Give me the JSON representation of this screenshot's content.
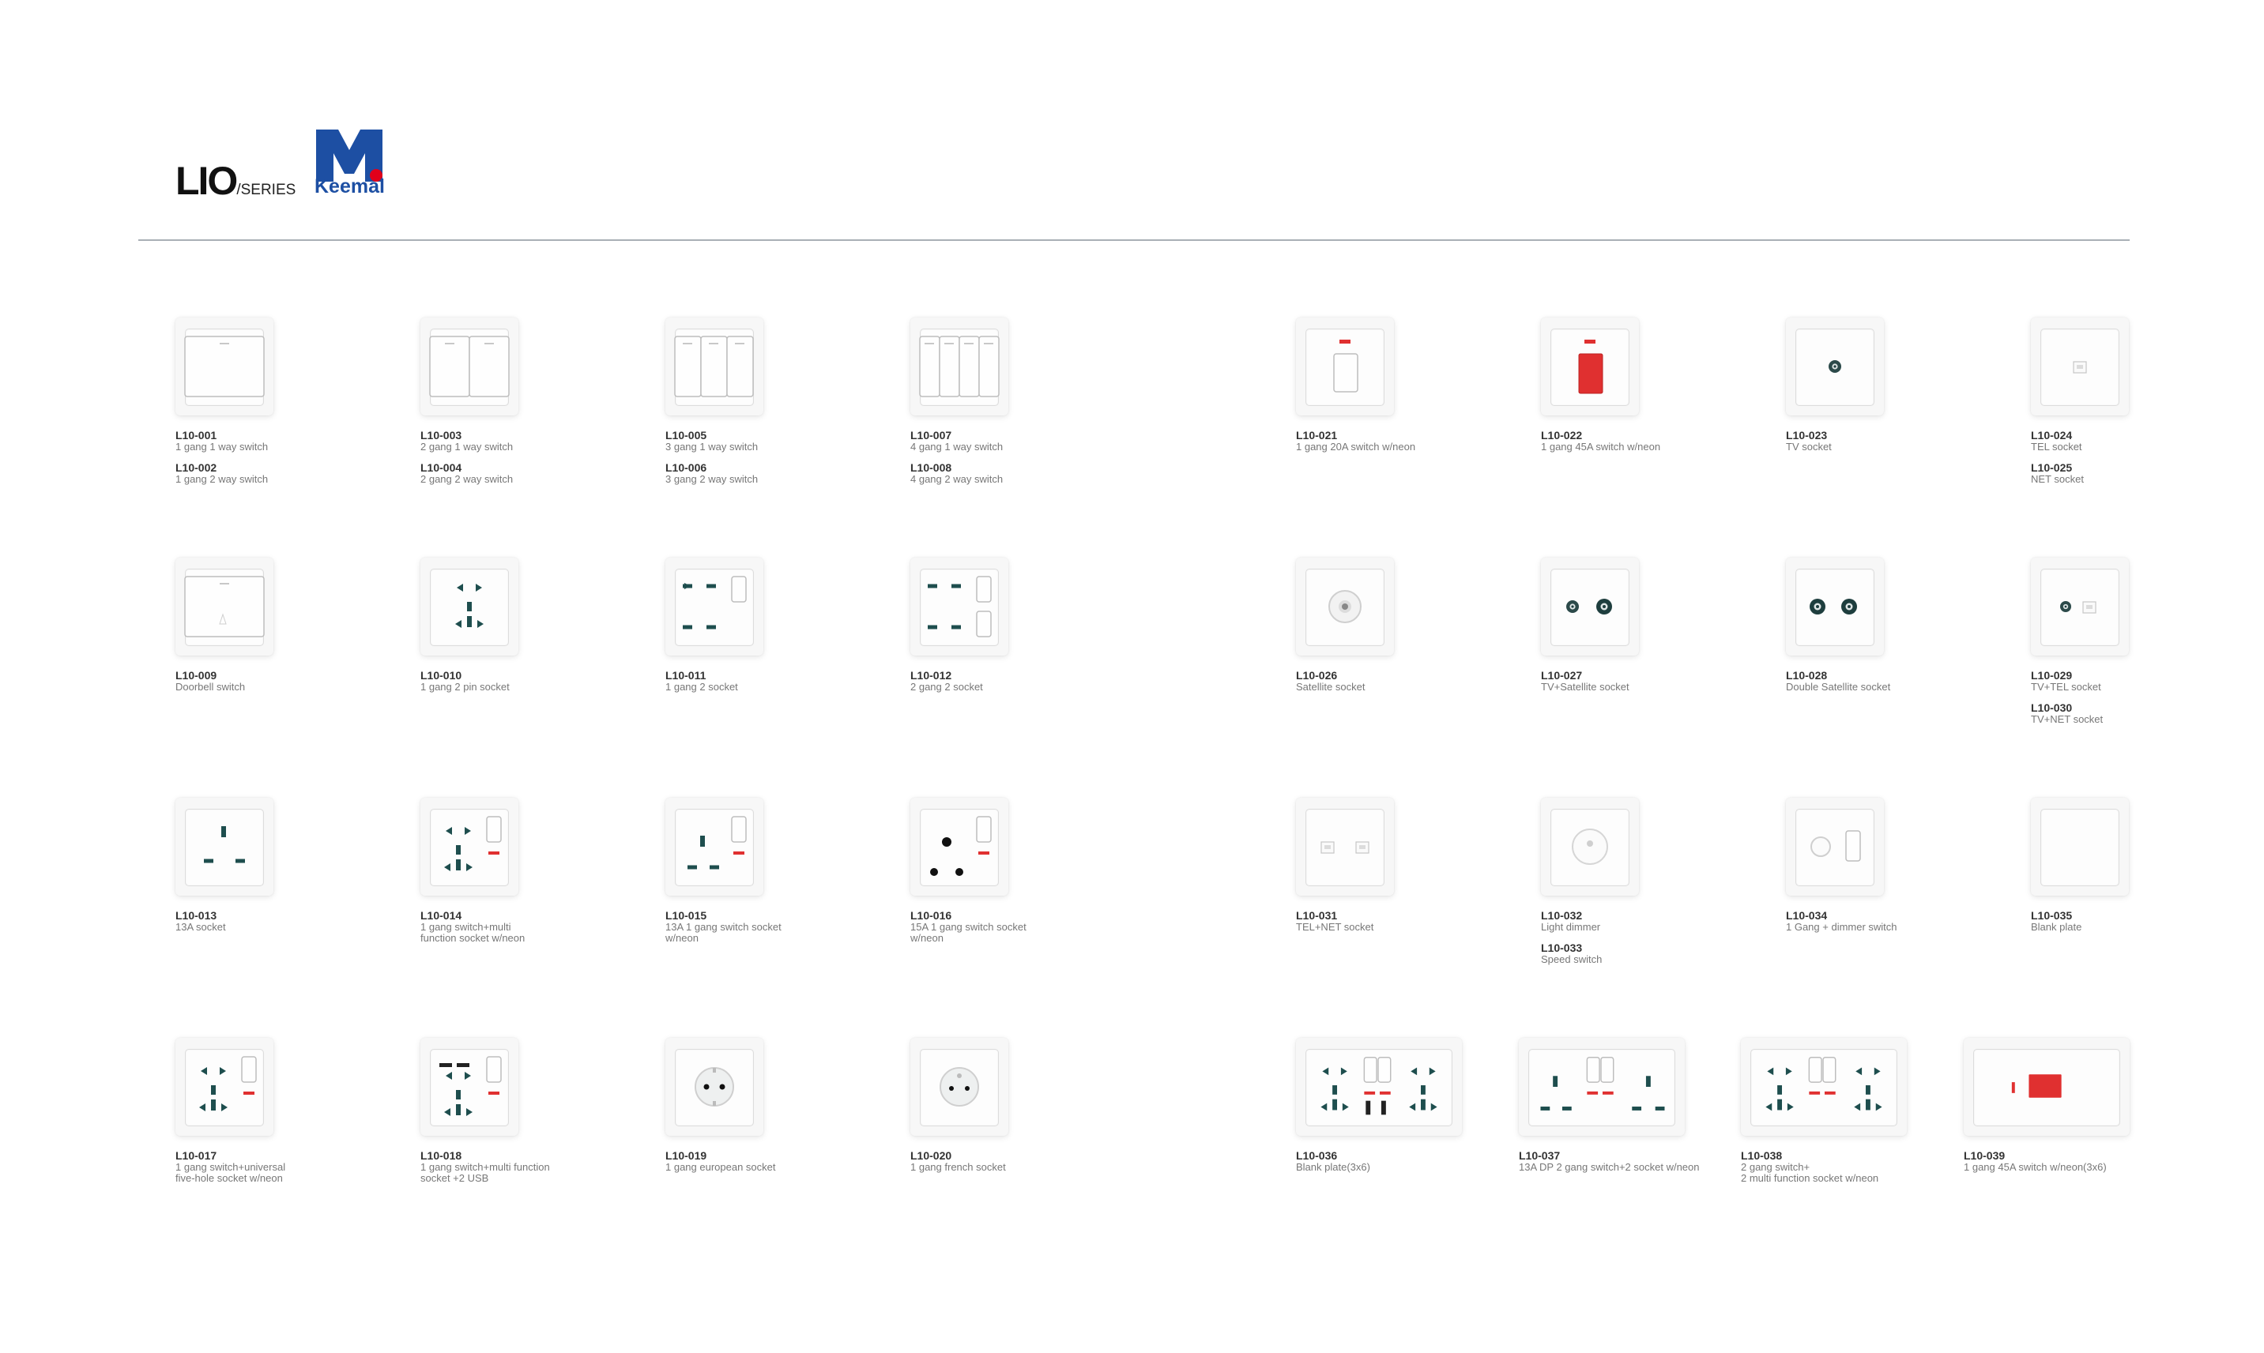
{
  "brand": {
    "series_big": "LIO",
    "series_small": "/SERIES",
    "logo_word": "Keemal"
  },
  "colors": {
    "accent_red": "#e03030",
    "socket_dark": "#1e4e4e",
    "logo_blue": "#1d4fa3",
    "logo_red": "#e1001a"
  },
  "products": [
    {
      "lines": [
        {
          "code": "L10-001",
          "desc": "1 gang 1 way switch"
        },
        {
          "code": "L10-002",
          "desc": "1 gang 2 way switch"
        }
      ],
      "icon": "switch-1-gang-icon"
    },
    {
      "lines": [
        {
          "code": "L10-003",
          "desc": "2 gang 1 way switch"
        },
        {
          "code": "L10-004",
          "desc": "2 gang 2 way switch"
        }
      ],
      "icon": "switch-2-gang-icon"
    },
    {
      "lines": [
        {
          "code": "L10-005",
          "desc": "3 gang 1 way switch"
        },
        {
          "code": "L10-006",
          "desc": "3 gang 2 way switch"
        }
      ],
      "icon": "switch-3-gang-icon"
    },
    {
      "lines": [
        {
          "code": "L10-007",
          "desc": "4 gang 1 way switch"
        },
        {
          "code": "L10-008",
          "desc": "4 gang 2 way switch"
        }
      ],
      "icon": "switch-4-gang-icon"
    },
    {
      "lines": [
        {
          "code": "L10-021",
          "desc": "1 gang 20A switch w/neon"
        }
      ],
      "icon": "switch-20a-icon"
    },
    {
      "lines": [
        {
          "code": "L10-022",
          "desc": "1 gang 45A switch w/neon"
        }
      ],
      "icon": "switch-45a-icon"
    },
    {
      "lines": [
        {
          "code": "L10-023",
          "desc": "TV socket"
        }
      ],
      "icon": "tv-socket-icon"
    },
    {
      "lines": [
        {
          "code": "L10-024",
          "desc": "TEL socket"
        },
        {
          "code": "L10-025",
          "desc": "NET socket"
        }
      ],
      "icon": "tel-socket-icon"
    },
    {
      "lines": [
        {
          "code": "L10-009",
          "desc": "Doorbell switch"
        }
      ],
      "icon": "doorbell-switch-icon"
    },
    {
      "lines": [
        {
          "code": "L10-010",
          "desc": "1 gang 2 pin socket"
        }
      ],
      "icon": "multi-socket-icon"
    },
    {
      "lines": [
        {
          "code": "L10-011",
          "desc": "1 gang 2 socket"
        }
      ],
      "icon": "two-pin-socket-switch-icon"
    },
    {
      "lines": [
        {
          "code": "L10-012",
          "desc": "2 gang 2 socket"
        }
      ],
      "icon": "two-pin-socket-2switch-icon"
    },
    {
      "lines": [
        {
          "code": "L10-026",
          "desc": "Satellite socket"
        }
      ],
      "icon": "satellite-socket-icon"
    },
    {
      "lines": [
        {
          "code": "L10-027",
          "desc": "TV+Satellite socket"
        }
      ],
      "icon": "tv-satellite-socket-icon"
    },
    {
      "lines": [
        {
          "code": "L10-028",
          "desc": "Double Satellite socket"
        }
      ],
      "icon": "double-satellite-socket-icon"
    },
    {
      "lines": [
        {
          "code": "L10-029",
          "desc": "TV+TEL socket"
        },
        {
          "code": "L10-030",
          "desc": "TV+NET socket"
        }
      ],
      "icon": "tv-tel-socket-icon"
    },
    {
      "lines": [
        {
          "code": "L10-013",
          "desc": "13A socket"
        }
      ],
      "icon": "uk-13a-socket-icon"
    },
    {
      "lines": [
        {
          "code": "L10-014",
          "desc": "1 gang switch+multi",
          "desc2": "function socket w/neon"
        }
      ],
      "icon": "multi-socket-switch-neon-icon"
    },
    {
      "lines": [
        {
          "code": "L10-015",
          "desc": "13A 1 gang switch socket",
          "desc2": "w/neon"
        }
      ],
      "icon": "uk-13a-switch-neon-icon"
    },
    {
      "lines": [
        {
          "code": "L10-016",
          "desc": "15A 1 gang switch socket",
          "desc2": "w/neon"
        }
      ],
      "icon": "round-15a-switch-neon-icon"
    },
    {
      "lines": [
        {
          "code": "L10-031",
          "desc": "TEL+NET socket"
        }
      ],
      "icon": "tel-net-socket-icon"
    },
    {
      "lines": [
        {
          "code": "L10-032",
          "desc": "Light dimmer"
        },
        {
          "code": "L10-033",
          "desc": "Speed switch"
        }
      ],
      "icon": "dimmer-knob-icon"
    },
    {
      "lines": [
        {
          "code": "L10-034",
          "desc": "1 Gang + dimmer switch"
        }
      ],
      "icon": "dimmer-switch-icon"
    },
    {
      "lines": [
        {
          "code": "L10-035",
          "desc": "Blank plate"
        }
      ],
      "icon": "blank-plate-icon"
    },
    {
      "lines": [
        {
          "code": "L10-017",
          "desc": "1 gang switch+universal",
          "desc2": "five-hole socket w/neon"
        }
      ],
      "icon": "universal-socket-switch-icon"
    },
    {
      "lines": [
        {
          "code": "L10-018",
          "desc": "1 gang switch+multi function",
          "desc2": "socket +2 USB"
        }
      ],
      "icon": "usb-socket-switch-icon"
    },
    {
      "lines": [
        {
          "code": "L10-019",
          "desc": "1 gang european socket"
        }
      ],
      "icon": "schuko-socket-icon"
    },
    {
      "lines": [
        {
          "code": "L10-020",
          "desc": "1 gang french socket"
        }
      ],
      "icon": "french-socket-icon"
    },
    {
      "lines": [
        {
          "code": "L10-036",
          "desc": "Blank plate(3x6)"
        }
      ],
      "icon": "double-socket-usb-icon"
    },
    {
      "lines": [
        {
          "code": "L10-037",
          "desc": "13A DP 2 gang switch+2 socket w/neon"
        }
      ],
      "icon": "double-uk-socket-icon"
    },
    {
      "lines": [
        {
          "code": "L10-038",
          "desc": "2 gang switch+",
          "desc2": "2 multi function socket w/neon"
        }
      ],
      "icon": "double-multi-socket-icon"
    },
    {
      "lines": [
        {
          "code": "L10-039",
          "desc": "1 gang 45A switch w/neon(3x6)"
        }
      ],
      "icon": "switch-45a-wide-icon"
    }
  ]
}
